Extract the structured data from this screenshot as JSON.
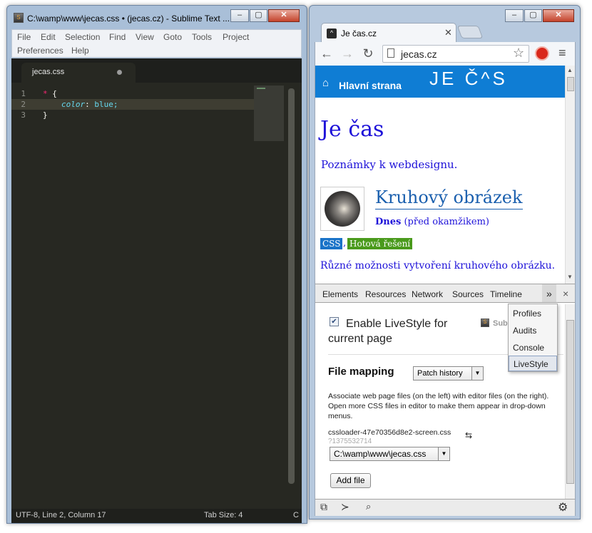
{
  "sublime": {
    "title": "C:\\wamp\\www\\jecas.css • (jecas.cz) - Sublime Text ...",
    "menu": [
      "File",
      "Edit",
      "Selection",
      "Find",
      "View",
      "Goto",
      "Tools",
      "Project",
      "Preferences",
      "Help"
    ],
    "tab": {
      "label": "jecas.css"
    },
    "code": {
      "line_numbers": [
        "1",
        "2",
        "3"
      ],
      "line1_selector": "*",
      "line1_brace": "{",
      "line2_property": "color",
      "line2_colon": ":",
      "line2_value": "blue;",
      "line3_brace": "}"
    },
    "status": {
      "left": "UTF-8, Line 2, Column 17",
      "tab_size": "Tab Size: 4",
      "syntax": "C"
    }
  },
  "chrome": {
    "tab_title": "Je čas.cz",
    "address": "jecas.cz",
    "page": {
      "home_label": "Hlavní strana",
      "logo": "JE Č^S",
      "h1": "Je čas",
      "tagline": "Poznámky k webdesignu.",
      "article_title": "Kruhový obrázek",
      "date_bold": "Dnes",
      "date_rest": "(před okamžikem)",
      "tags": [
        "CSS",
        "Hotová řešení"
      ],
      "tag_separator": ",",
      "excerpt": "Různé možnosti vytvoření kruhového obrázku."
    },
    "devtools": {
      "tabs": [
        "Elements",
        "Resources",
        "Network",
        "Sources",
        "Timeline"
      ],
      "more_label": "»",
      "close_label": "×",
      "overflow_menu": [
        "Profiles",
        "Audits",
        "Console",
        "LiveStyle"
      ],
      "livestyle": {
        "enable_label": "Enable LiveStyle for current page",
        "sublime_hint": "Sub",
        "file_mapping_heading": "File mapping",
        "patch_select": "Patch history",
        "description": "Associate web page files (on the left) with editor files (on the right). Open more CSS files in editor to make them appear in drop-down menus.",
        "source_file": "cssloader-47e70356d8e2-screen.css",
        "source_query": "?1375532714",
        "editor_file": "C:\\wamp\\www\\jecas.css",
        "add_file_button": "Add file"
      }
    }
  },
  "colors": {
    "sublime_bg": "#272822",
    "site_header": "#0f7dd4",
    "tag_css": "#1a73c8",
    "tag_hotova": "#4a9a1c",
    "link_blue": "#1a0dab"
  }
}
